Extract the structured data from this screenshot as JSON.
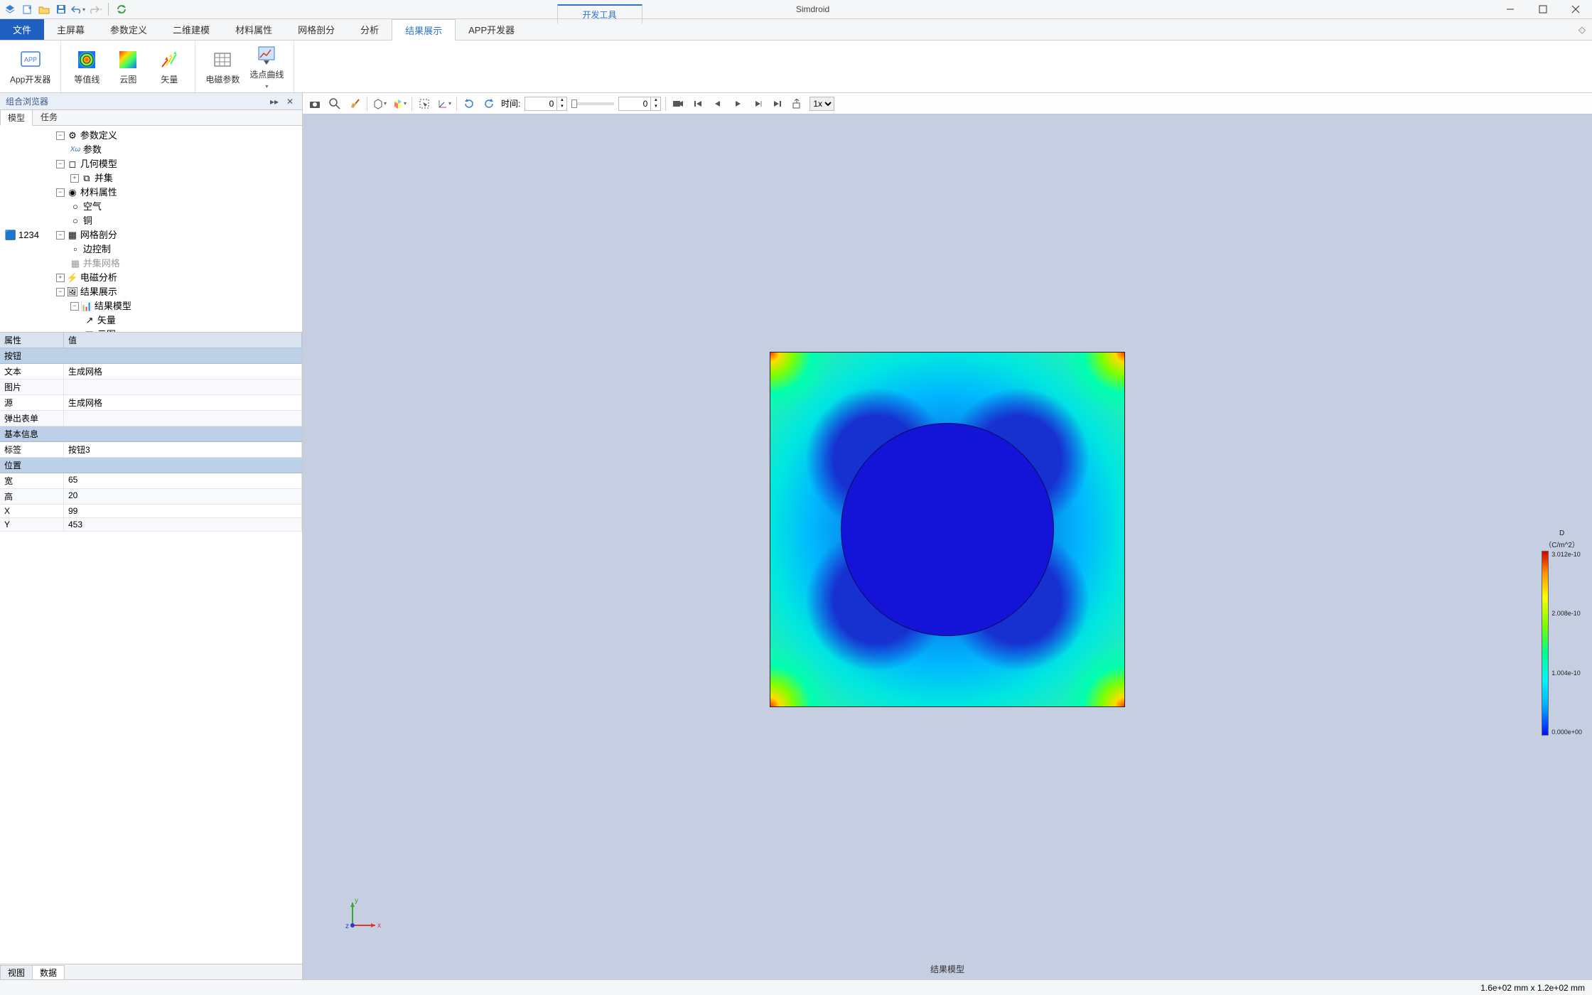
{
  "window": {
    "dev_tools_tab": "开发工具",
    "app_title": "Simdroid"
  },
  "qat": [
    "layers-icon",
    "new-icon",
    "open-icon",
    "save-icon",
    "undo-icon",
    "redo-icon",
    "refresh-icon"
  ],
  "menu": {
    "file": "文件",
    "tabs": [
      "主屏幕",
      "参数定义",
      "二维建模",
      "材料属性",
      "网格剖分",
      "分析",
      "结果展示",
      "APP开发器"
    ],
    "active_index": 6
  },
  "ribbon_groups": [
    {
      "items": [
        {
          "icon": "app-icon",
          "label": "App开发器"
        }
      ]
    },
    {
      "items": [
        {
          "icon": "contour-rainbow-icon",
          "label": "等值线"
        },
        {
          "icon": "cloud-rainbow-icon",
          "label": "云图"
        },
        {
          "icon": "vector-rainbow-icon",
          "label": "矢量"
        }
      ]
    },
    {
      "items": [
        {
          "icon": "em-grid-icon",
          "label": "电磁参数"
        },
        {
          "icon": "pick-curve-icon",
          "label": "选点曲线"
        }
      ]
    }
  ],
  "left_panel": {
    "title": "组合浏览器",
    "top_tabs": [
      "模型",
      "任务"
    ],
    "top_active": 0,
    "bottom_tabs": [
      "视图",
      "数据"
    ],
    "bottom_active": 1
  },
  "tree": {
    "root": "1234",
    "nodes": {
      "param_def": "参数定义",
      "params": "参数",
      "geom": "几何模型",
      "union": "并集",
      "material": "材料属性",
      "air": "空气",
      "copper": "铜",
      "mesh": "网格剖分",
      "edge_ctrl": "边控制",
      "union_mesh": "并集网格",
      "em": "电磁分析",
      "result": "结果展示",
      "result_model": "结果模型",
      "vector": "矢量",
      "cloud": "云图"
    }
  },
  "props": {
    "header_name": "属性",
    "header_value": "值",
    "cat_button": "按钮",
    "rows_button": [
      {
        "n": "文本",
        "v": "生成网格"
      },
      {
        "n": "图片",
        "v": ""
      },
      {
        "n": "源",
        "v": "生成网格"
      },
      {
        "n": "弹出表单",
        "v": ""
      }
    ],
    "cat_basic": "基本信息",
    "rows_basic": [
      {
        "n": "标签",
        "v": "按钮3"
      }
    ],
    "cat_pos": "位置",
    "rows_pos": [
      {
        "n": "宽",
        "v": "65"
      },
      {
        "n": "高",
        "v": "20"
      },
      {
        "n": "X",
        "v": "99"
      },
      {
        "n": "Y",
        "v": "453"
      }
    ]
  },
  "viewport": {
    "time_label": "时间:",
    "time_value": "0",
    "end_value": "0",
    "speed": "1x",
    "caption": "结果模型"
  },
  "legend": {
    "title": "D",
    "unit": "（C/m^2）",
    "ticks": [
      "3.012e-10",
      "2.008e-10",
      "1.004e-10",
      "0.000e+00"
    ]
  },
  "statusbar": {
    "dims": "1.6e+02 mm x 1.2e+02 mm"
  }
}
